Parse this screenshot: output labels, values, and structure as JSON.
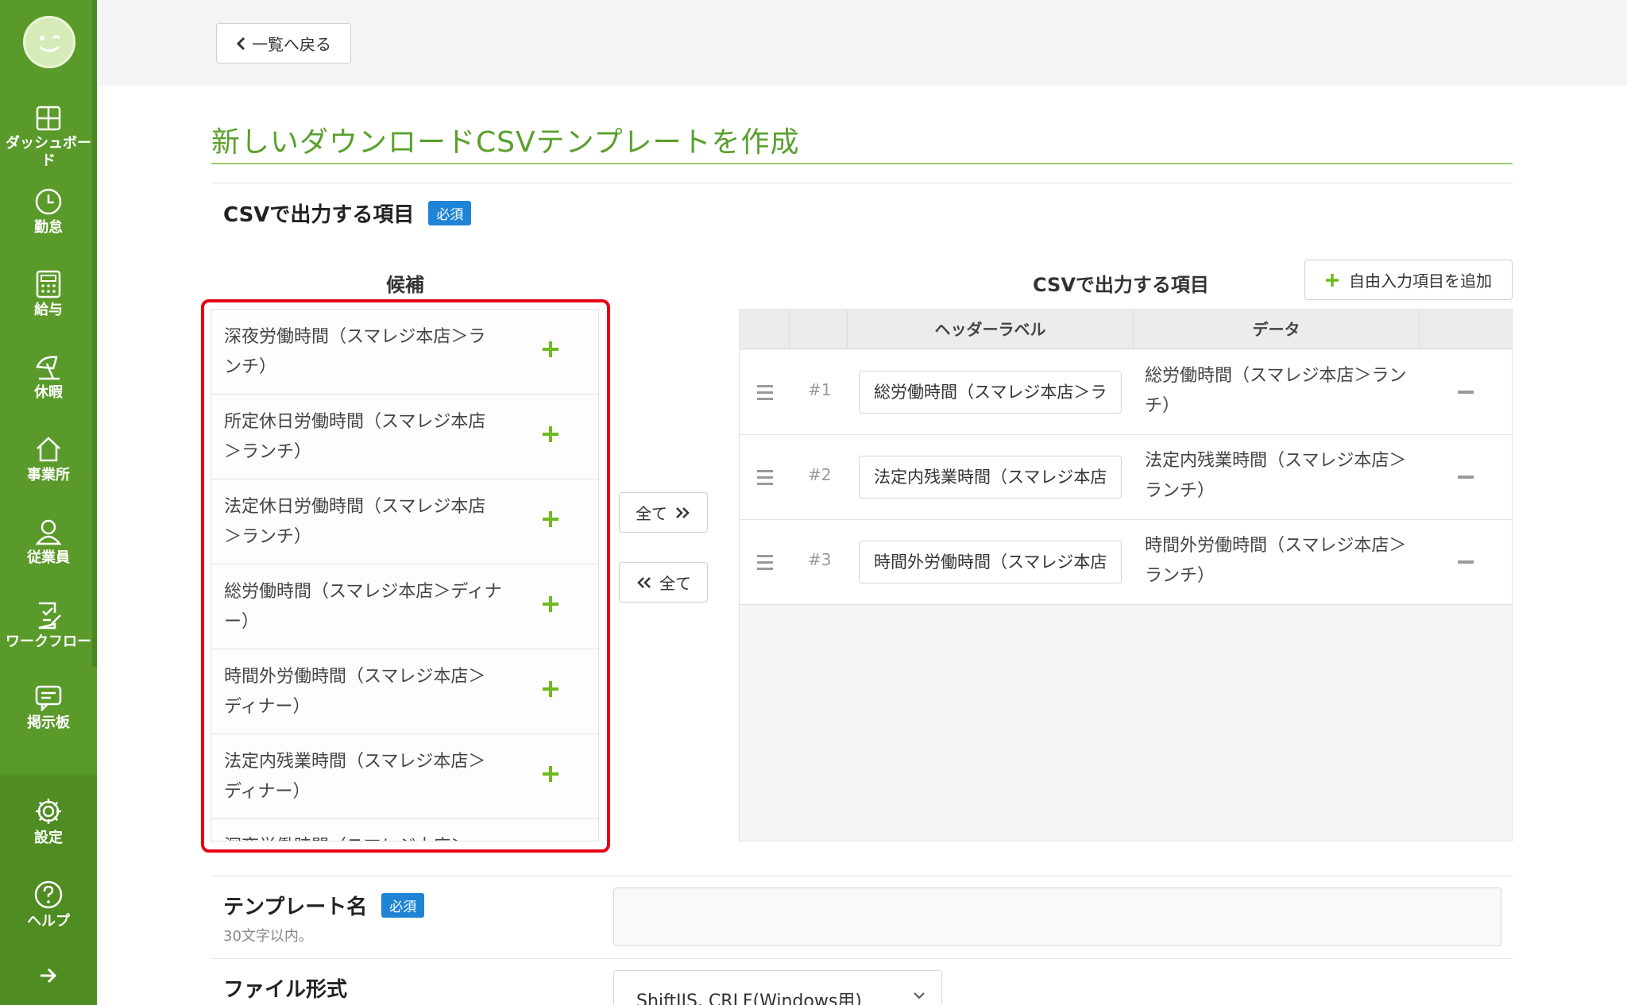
{
  "sidebar": {
    "items": [
      {
        "label": "ダッシュボード",
        "icon": "dashboard-icon"
      },
      {
        "label": "勤怠",
        "icon": "clock-icon"
      },
      {
        "label": "給与",
        "icon": "calculator-icon"
      },
      {
        "label": "休暇",
        "icon": "beach-umbrella-icon"
      },
      {
        "label": "事業所",
        "icon": "home-icon"
      },
      {
        "label": "従業員",
        "icon": "person-icon"
      },
      {
        "label": "ワークフロー",
        "icon": "checklist-icon"
      },
      {
        "label": "掲示板",
        "icon": "chat-icon"
      }
    ],
    "bottom": [
      {
        "label": "設定",
        "icon": "gear-icon"
      },
      {
        "label": "ヘルプ",
        "icon": "help-icon"
      }
    ],
    "expand_icon": "arrow-right-icon",
    "accent": "#5a9a2a"
  },
  "toolbar": {
    "back_label": "一覧へ戻る"
  },
  "page": {
    "title": "新しいダウンロードCSVテンプレートを作成"
  },
  "csv_section": {
    "label": "CSVで出力する項目",
    "required": "必須",
    "candidates_header": "候補",
    "output_header": "CSVで出力する項目",
    "add_free_label": "自由入力項目を追加",
    "move_all_right": "全て",
    "move_all_left": "全て",
    "candidates": [
      "深夜労働時間（スマレジ本店＞ランチ）",
      "所定休日労働時間（スマレジ本店＞ランチ）",
      "法定休日労働時間（スマレジ本店＞ランチ）",
      "総労働時間（スマレジ本店＞ディナー）",
      "時間外労働時間（スマレジ本店＞ディナー）",
      "法定内残業時間（スマレジ本店＞ディナー）",
      "深夜労働時間（スマレジ本店＞"
    ],
    "table_headers": {
      "header_label": "ヘッダーラベル",
      "data": "データ"
    },
    "rows": [
      {
        "num": "#1",
        "header": "総労働時間（スマレジ本店＞ラ",
        "data": "総労働時間（スマレジ本店＞ランチ）"
      },
      {
        "num": "#2",
        "header": "法定内残業時間（スマレジ本店",
        "data": "法定内残業時間（スマレジ本店＞ランチ）"
      },
      {
        "num": "#3",
        "header": "時間外労働時間（スマレジ本店",
        "data": "時間外労働時間（スマレジ本店＞ランチ）"
      }
    ]
  },
  "template_name": {
    "label": "テンプレート名",
    "required": "必須",
    "hint": "30文字以内。",
    "value": ""
  },
  "file_format": {
    "label": "ファイル形式",
    "selected": "ShiftJIS, CRLF(Windows用)"
  }
}
